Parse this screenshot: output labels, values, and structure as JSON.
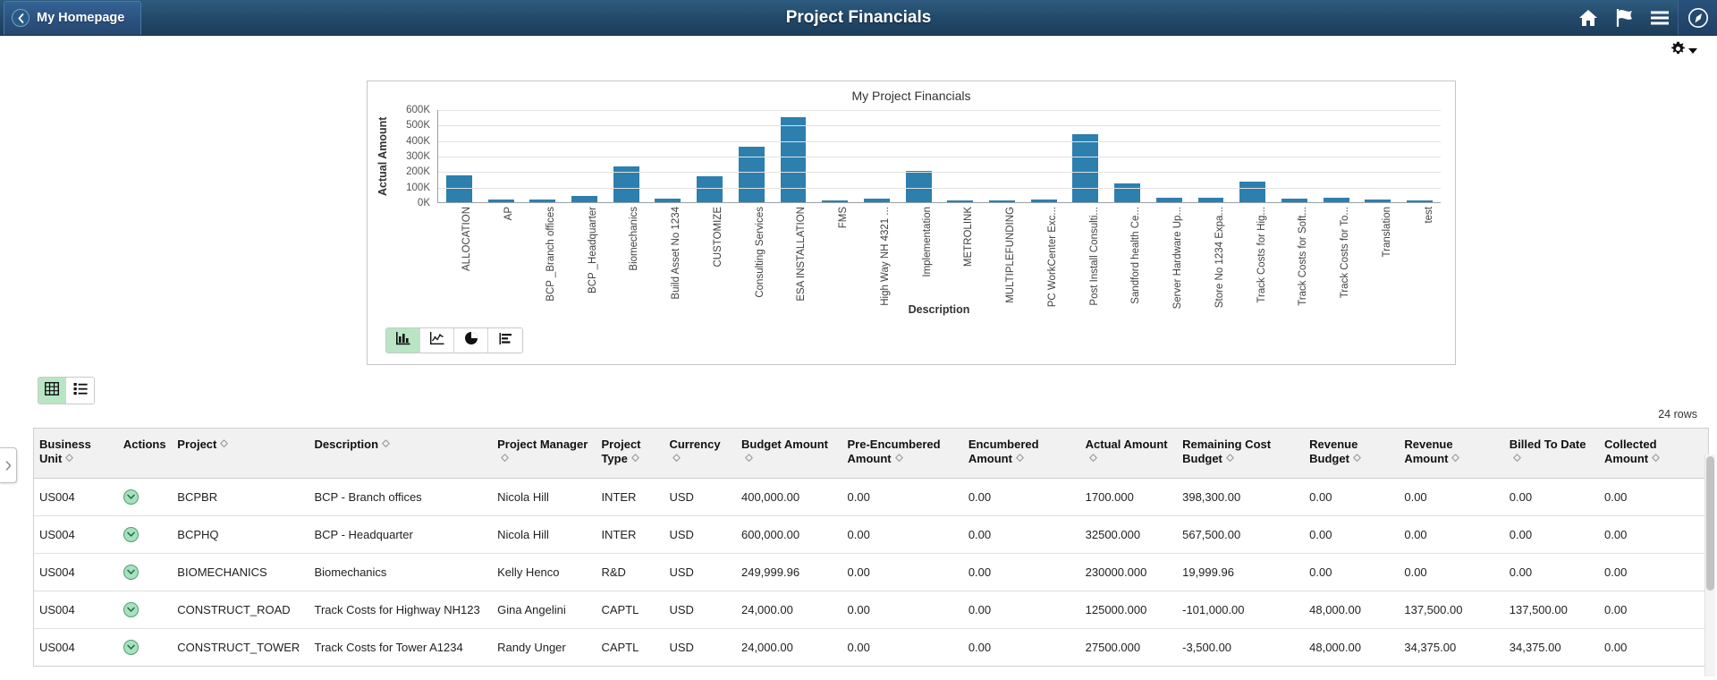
{
  "header": {
    "back_label": "My Homepage",
    "back_icon": "chevron-left-icon",
    "title": "Project Financials",
    "icons": [
      {
        "name": "home-icon",
        "label": "Home"
      },
      {
        "name": "flag-icon",
        "label": "Notifications"
      },
      {
        "name": "hamburger-menu-icon",
        "label": "Actions Menu"
      },
      {
        "name": "navigator-compass-icon",
        "label": "NavBar"
      }
    ]
  },
  "toolbar": {
    "gear_icon": "gear-icon",
    "gear_caret": "chevron-down-icon"
  },
  "chart_panel": {
    "chart_types": [
      {
        "name": "bar-chart-type-button",
        "icon": "bar-chart-icon",
        "active": true
      },
      {
        "name": "line-chart-type-button",
        "icon": "line-chart-icon",
        "active": false
      },
      {
        "name": "pie-chart-type-button",
        "icon": "pie-chart-icon",
        "active": false
      },
      {
        "name": "horizontal-bar-chart-type-button",
        "icon": "horizontal-bar-chart-icon",
        "active": false
      }
    ]
  },
  "chart_data": {
    "type": "bar",
    "title": "My Project Financials",
    "xlabel": "Description",
    "ylabel": "Actual Amount",
    "ylim": [
      0,
      600000
    ],
    "ytick_labels": [
      "0K",
      "100K",
      "200K",
      "300K",
      "400K",
      "500K",
      "600K"
    ],
    "ytick_values": [
      0,
      100000,
      200000,
      300000,
      400000,
      500000,
      600000
    ],
    "grid": true,
    "legend": "none",
    "bar_color": "#2d7fae",
    "categories": [
      "ALLOCATION",
      "AP",
      "BCP _Branch offices",
      "BCP _Headquarter",
      "Biomechanics",
      "Build Asset No 1234",
      "CUSTOMIZE",
      "Consulting Services",
      "ESA INSTALLATION",
      "FMS",
      "High Way NH 4321 ...",
      "Implementation",
      "METROLINK",
      "MULTIPLEFUNDING",
      "PC WorkCenter Exc...",
      "Post Install Consulti...",
      "Sandford health Ce...",
      "Server Hardware Up...",
      "Store No 1234 Expa...",
      "Track Costs for Hig...",
      "Track Costs for Soft...",
      "Track Costs for To...",
      "Translation",
      "test"
    ],
    "values": [
      175000,
      16000,
      18000,
      38000,
      230000,
      26000,
      165000,
      355000,
      550000,
      14000,
      24000,
      200000,
      14000,
      12000,
      18000,
      440000,
      120000,
      30000,
      30000,
      135000,
      25000,
      27000,
      16000,
      14000
    ]
  },
  "view_toggle": [
    {
      "name": "grid-view-button",
      "icon": "grid-icon",
      "active": true
    },
    {
      "name": "list-view-button",
      "icon": "list-icon",
      "active": false
    }
  ],
  "grid": {
    "rows_count_label": "24 rows",
    "columns": [
      {
        "label": "Business Unit",
        "sortable": true
      },
      {
        "label": "Actions",
        "sortable": false
      },
      {
        "label": "Project",
        "sortable": true
      },
      {
        "label": "Description",
        "sortable": true
      },
      {
        "label": "Project Manager",
        "sortable": true
      },
      {
        "label": "Project Type",
        "sortable": true
      },
      {
        "label": "Currency",
        "sortable": true
      },
      {
        "label": "Budget Amount",
        "sortable": true
      },
      {
        "label": "Pre-Encumbered Amount",
        "sortable": true
      },
      {
        "label": "Encumbered Amount",
        "sortable": true
      },
      {
        "label": "Actual Amount",
        "sortable": true
      },
      {
        "label": "Remaining Cost Budget",
        "sortable": true
      },
      {
        "label": "Revenue Budget",
        "sortable": true
      },
      {
        "label": "Revenue Amount",
        "sortable": true
      },
      {
        "label": "Billed To Date",
        "sortable": true
      },
      {
        "label": "Collected Amount",
        "sortable": true
      }
    ],
    "rows": [
      {
        "business_unit": "US004",
        "action_icon": "chevron-down-circle-icon",
        "project": "BCPBR",
        "description": "BCP - Branch offices",
        "project_manager": "Nicola Hill",
        "project_type": "INTER",
        "currency": "USD",
        "budget_amount": "400,000.00",
        "pre_encumbered_amount": "0.00",
        "encumbered_amount": "0.00",
        "actual_amount": "1700.000",
        "remaining_cost_budget": "398,300.00",
        "revenue_budget": "0.00",
        "revenue_amount": "0.00",
        "billed_to_date": "0.00",
        "collected_amount": "0.00"
      },
      {
        "business_unit": "US004",
        "action_icon": "chevron-down-circle-icon",
        "project": "BCPHQ",
        "description": "BCP - Headquarter",
        "project_manager": "Nicola Hill",
        "project_type": "INTER",
        "currency": "USD",
        "budget_amount": "600,000.00",
        "pre_encumbered_amount": "0.00",
        "encumbered_amount": "0.00",
        "actual_amount": "32500.000",
        "remaining_cost_budget": "567,500.00",
        "revenue_budget": "0.00",
        "revenue_amount": "0.00",
        "billed_to_date": "0.00",
        "collected_amount": "0.00"
      },
      {
        "business_unit": "US004",
        "action_icon": "chevron-down-circle-icon",
        "project": "BIOMECHANICS",
        "description": "Biomechanics",
        "project_manager": "Kelly Henco",
        "project_type": "R&D",
        "currency": "USD",
        "budget_amount": "249,999.96",
        "pre_encumbered_amount": "0.00",
        "encumbered_amount": "0.00",
        "actual_amount": "230000.000",
        "remaining_cost_budget": "19,999.96",
        "revenue_budget": "0.00",
        "revenue_amount": "0.00",
        "billed_to_date": "0.00",
        "collected_amount": "0.00"
      },
      {
        "business_unit": "US004",
        "action_icon": "chevron-down-circle-icon",
        "project": "CONSTRUCT_ROAD",
        "description": "Track Costs for Highway NH123",
        "project_manager": "Gina Angelini",
        "project_type": "CAPTL",
        "currency": "USD",
        "budget_amount": "24,000.00",
        "pre_encumbered_amount": "0.00",
        "encumbered_amount": "0.00",
        "actual_amount": "125000.000",
        "remaining_cost_budget": "-101,000.00",
        "revenue_budget": "48,000.00",
        "revenue_amount": "137,500.00",
        "billed_to_date": "137,500.00",
        "collected_amount": "0.00"
      },
      {
        "business_unit": "US004",
        "action_icon": "chevron-down-circle-icon",
        "project": "CONSTRUCT_TOWER",
        "description": "Track Costs for Tower A1234",
        "project_manager": "Randy Unger",
        "project_type": "CAPTL",
        "currency": "USD",
        "budget_amount": "24,000.00",
        "pre_encumbered_amount": "0.00",
        "encumbered_amount": "0.00",
        "actual_amount": "27500.000",
        "remaining_cost_budget": "-3,500.00",
        "revenue_budget": "48,000.00",
        "revenue_amount": "34,375.00",
        "billed_to_date": "34,375.00",
        "collected_amount": "0.00"
      }
    ]
  }
}
